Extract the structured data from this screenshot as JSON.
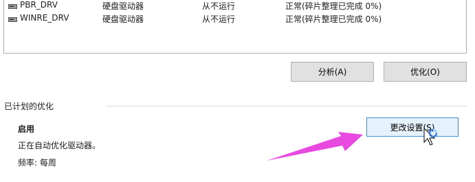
{
  "drives": [
    {
      "name": "PBR_DRV",
      "media_type": "硬盘驱动器",
      "last_run": "从不运行",
      "status": "正常(碎片整理已完成 0%)"
    },
    {
      "name": "WINRE_DRV",
      "media_type": "硬盘驱动器",
      "last_run": "从不运行",
      "status": "正常(碎片整理已完成 0%)"
    }
  ],
  "buttons": {
    "analyze": "分析(A)",
    "optimize": "优化(O)"
  },
  "scheduled": {
    "section_title": "已计划的优化",
    "state": "启用",
    "description": "正在自动优化驱动器。",
    "frequency": "频率: 每周",
    "change_settings": "更改设置(S)"
  },
  "colors": {
    "arrow": "#e84ae0",
    "focus_border": "#3c8fd6",
    "focus_fill": "#e5f1fb"
  },
  "icons": {
    "drive": "drive-icon",
    "pointer": "mouse-pointer-icon",
    "busy": "busy-spinner-icon"
  }
}
